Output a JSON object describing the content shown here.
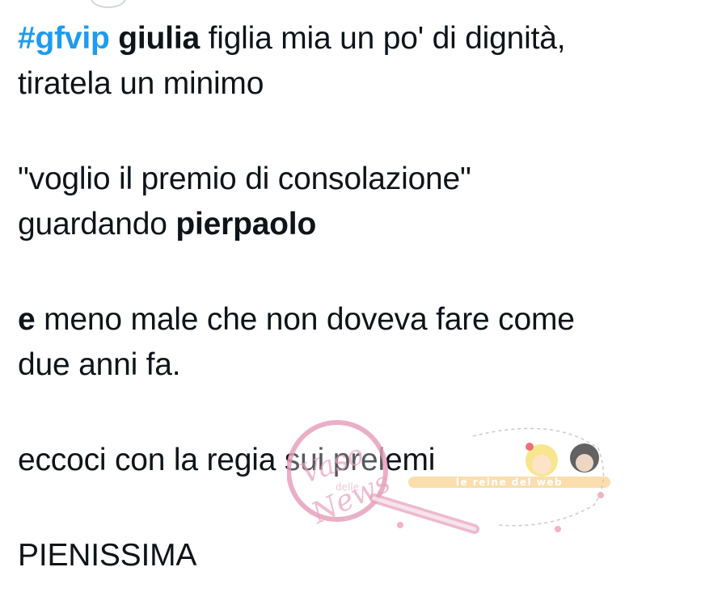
{
  "tweet": {
    "p1": {
      "hashtag": "#gfvip",
      "name": "giulia",
      "rest": " figlia mia un po' di dignità,",
      "line2": "tiratela un minimo"
    },
    "p2": {
      "line1": "\"voglio il premio di consolazione\"",
      "prefix": "guardando ",
      "name": "pierpaolo"
    },
    "p3": {
      "word": "e",
      "rest": " meno male che non doveva fare come",
      "line2": "due anni fa."
    },
    "p4": {
      "line1": "eccoci con la regia sui prelemi"
    },
    "p5": {
      "line1": "PIENISSIMA"
    }
  },
  "watermark": {
    "logo_text": "Vaso delle News",
    "banner_text": "le reine del web"
  },
  "colors": {
    "text": "#0f1419",
    "hashtag": "#1d9bf0",
    "watermark_pink": "#e7a2bd"
  }
}
